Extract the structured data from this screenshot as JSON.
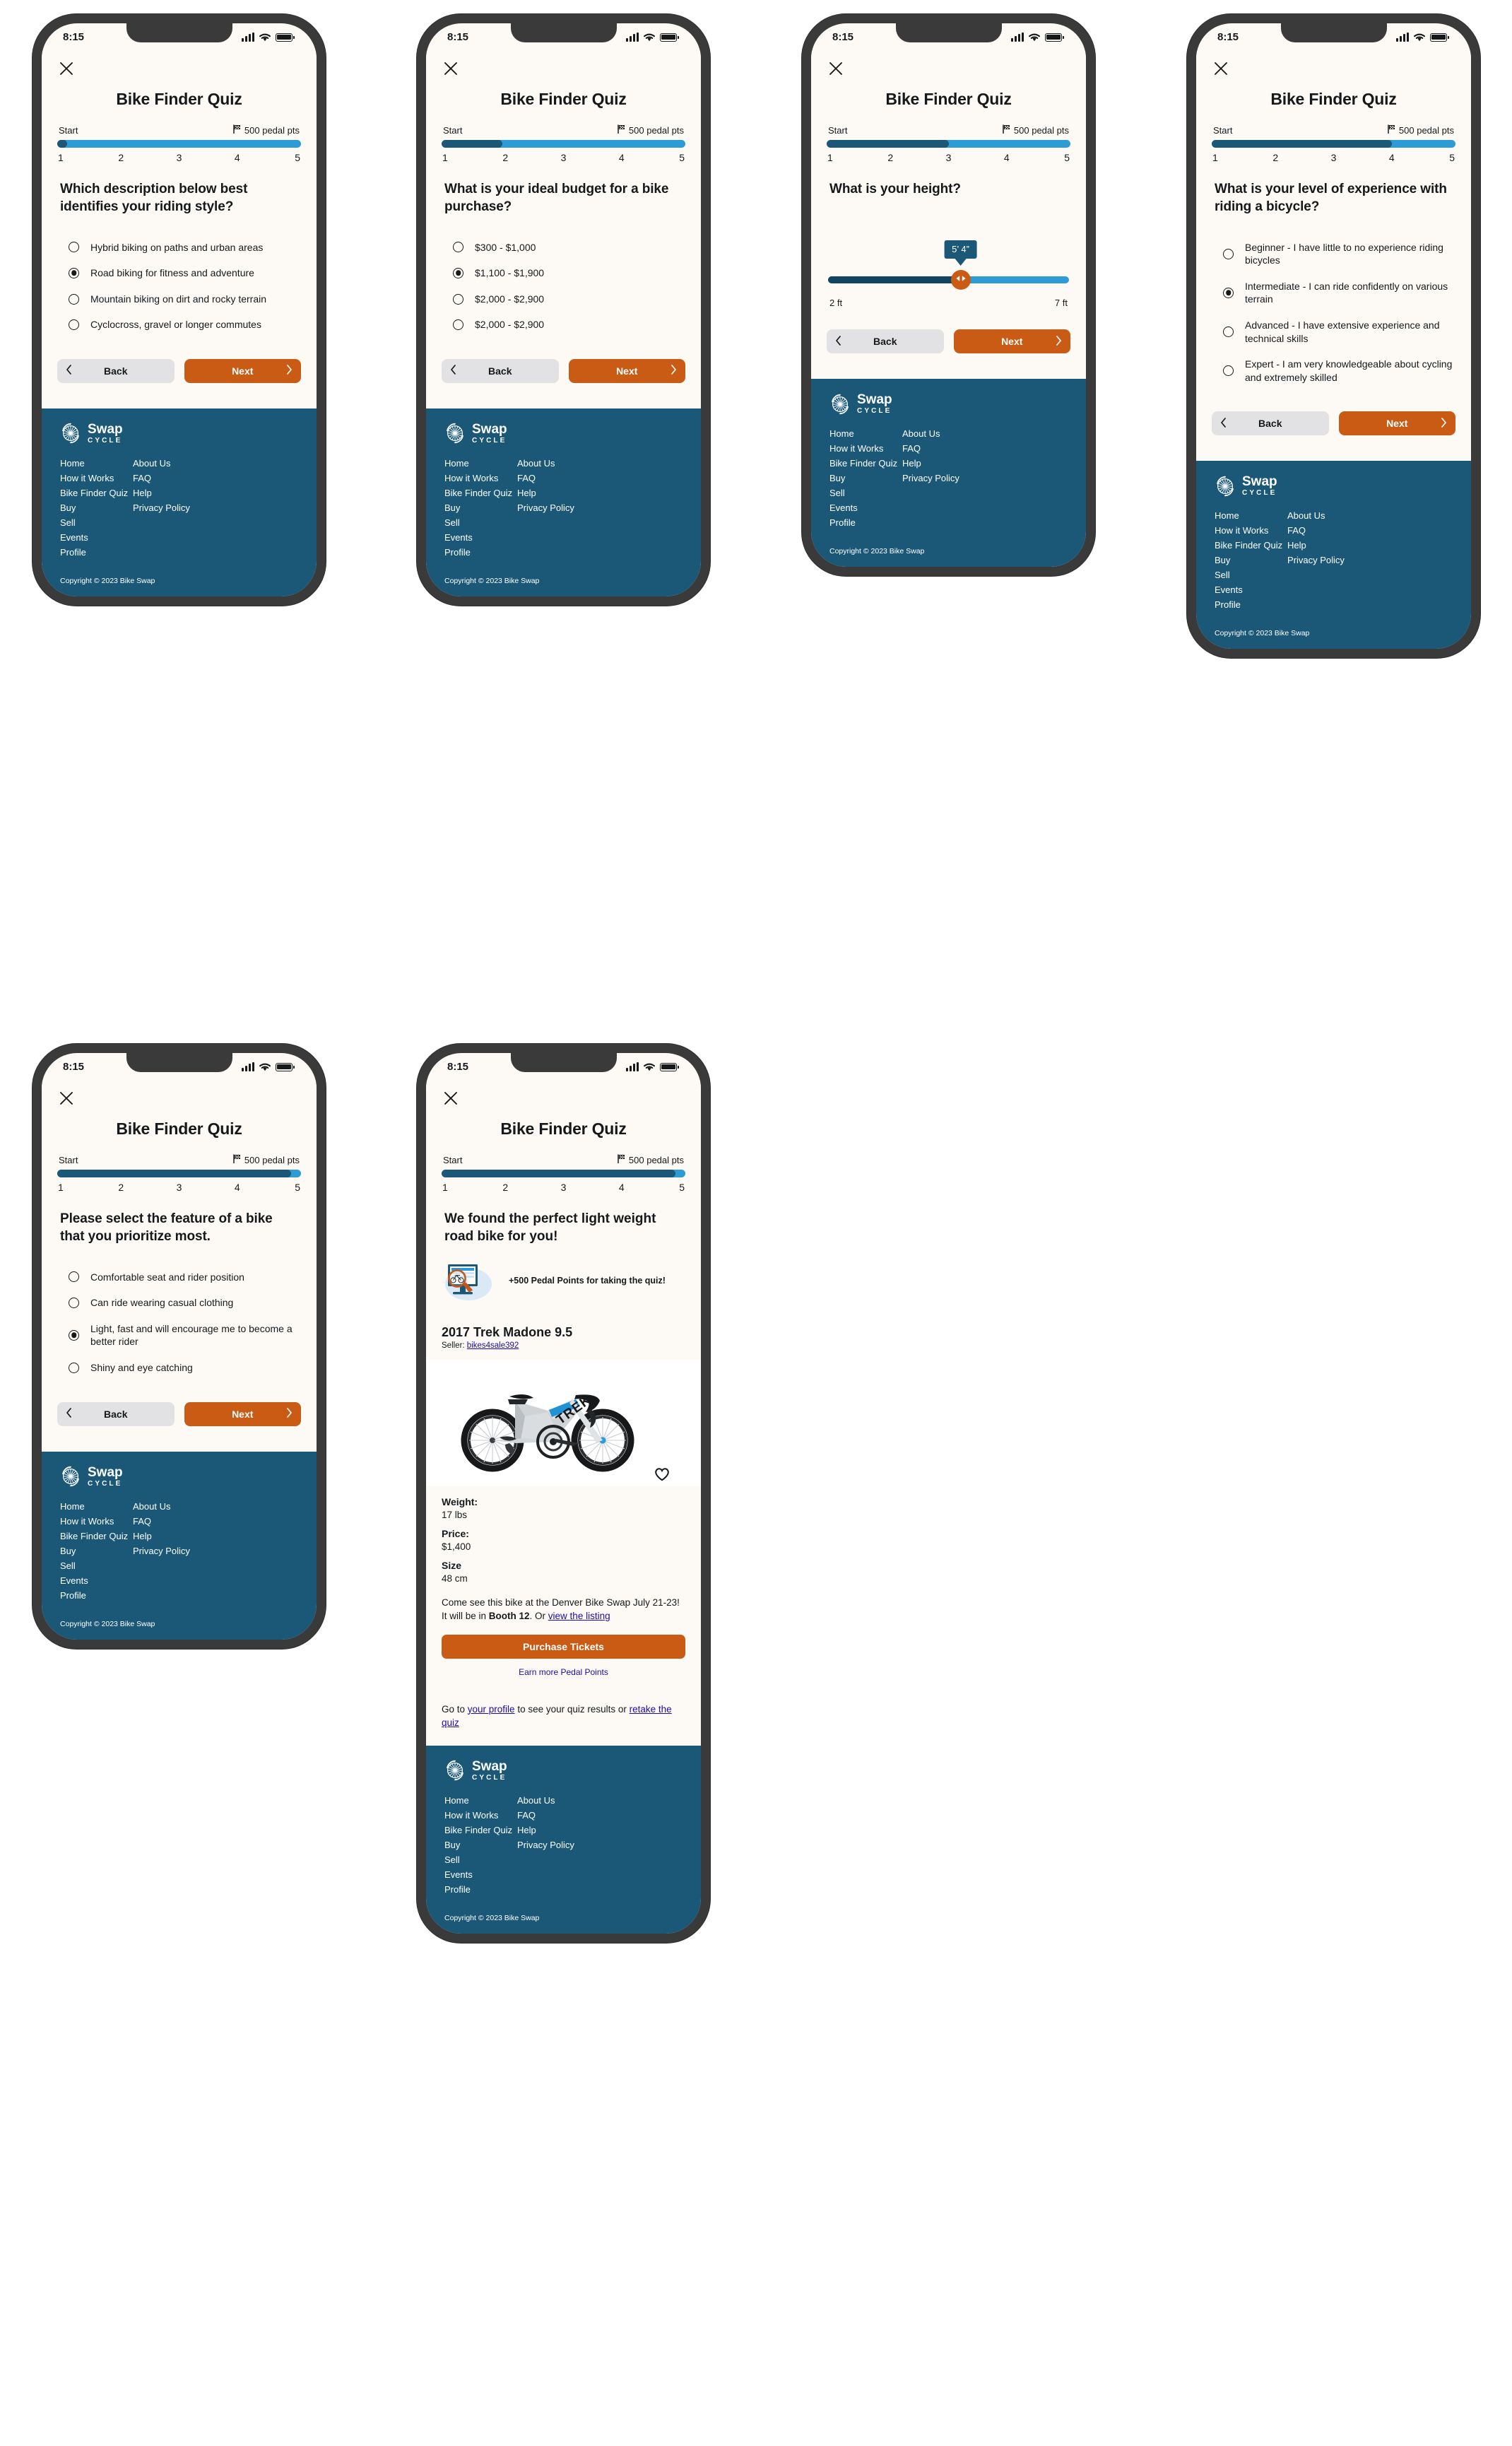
{
  "colors": {
    "screen_bg": "#fdfaf5",
    "bezel": "#3a3a3a",
    "brand_navy": "#1b5878",
    "brand_blue": "#2d9cd6",
    "accent_orange": "#ca5b15",
    "link_blue": "#1a0dab",
    "text": "#15191c",
    "btn_back_bg": "#e2e2e4"
  },
  "status_bar": {
    "time": "8:15",
    "icons": [
      "signal-icon",
      "wifi-icon",
      "battery-icon"
    ]
  },
  "quiz": {
    "title": "Bike Finder Quiz",
    "close_icon": "close-icon",
    "progress": {
      "start_label": "Start",
      "finish_label": "500 pedal pts",
      "finish_icon": "checkered-flag-icon",
      "ticks": [
        "1",
        "2",
        "3",
        "4",
        "5"
      ]
    },
    "buttons": {
      "back": "Back",
      "next": "Next",
      "back_icon": "chevron-left-icon",
      "next_icon": "chevron-right-icon"
    }
  },
  "screens": [
    {
      "step": 1,
      "progress_pct": 4,
      "question": "Which description below best identifies your riding style?",
      "options": [
        {
          "label": "Hybrid biking on paths and urban areas",
          "selected": false
        },
        {
          "label": "Road biking for fitness and adventure",
          "selected": true
        },
        {
          "label": "Mountain biking on dirt and rocky terrain",
          "selected": false
        },
        {
          "label": "Cyclocross, gravel or longer commutes",
          "selected": false
        }
      ]
    },
    {
      "step": 2,
      "progress_pct": 25,
      "question": "What is your ideal budget for a bike purchase?",
      "options": [
        {
          "label": "$300 - $1,000",
          "selected": false
        },
        {
          "label": "$1,100 - $1,900",
          "selected": true
        },
        {
          "label": "$2,000 - $2,900",
          "selected": false
        },
        {
          "label": "$2,000 - $2,900",
          "selected": false
        }
      ]
    },
    {
      "step": 3,
      "progress_pct": 50,
      "question": "What is your height?",
      "slider": {
        "value_label": "5’ 4”",
        "min_label": "2 ft",
        "max_label": "7 ft",
        "thumb_pct": 55,
        "thumb_icon": "left-right-arrows-icon"
      }
    },
    {
      "step": 4,
      "progress_pct": 74,
      "question": "What is your level of experience with riding a bicycle?",
      "options": [
        {
          "label": "Beginner - I have little to no experience riding bicycles",
          "selected": false
        },
        {
          "label": "Intermediate - I can ride confidently on various terrain",
          "selected": true
        },
        {
          "label": "Advanced - I have extensive experience and technical skills",
          "selected": false
        },
        {
          "label": "Expert - I am very knowledgeable about cycling and extremely skilled",
          "selected": false
        }
      ]
    },
    {
      "step": 5,
      "progress_pct": 96,
      "question": "Please select the feature of a bike that you prioritize most.",
      "options": [
        {
          "label": "Comfortable seat and rider position",
          "selected": false
        },
        {
          "label": "Can ride wearing casual clothing",
          "selected": false
        },
        {
          "label": "Light, fast and will encourage me to become a better rider",
          "selected": true
        },
        {
          "label": "Shiny and eye catching",
          "selected": false
        }
      ]
    }
  ],
  "results": {
    "step": 5,
    "progress_pct": 96,
    "headline": "We found the perfect light weight road bike for you!",
    "reward_illustration_icon": "bike-search-illustration",
    "reward_text": "+500 Pedal Points for taking the quiz!",
    "bike_name": "2017 Trek Madone 9.5",
    "seller_prefix": "Seller: ",
    "seller_name": "bikes4sale392",
    "bike_photo_icon": "road-bike-photo",
    "favorite_icon": "heart-icon",
    "specs": [
      {
        "label": "Weight:",
        "value": "17 lbs"
      },
      {
        "label": "Price:",
        "value": "$1,400"
      },
      {
        "label": "Size",
        "value": "48 cm"
      }
    ],
    "blurb_part1": "Come see this bike at the Denver Bike Swap July 21-23! It will be in ",
    "blurb_booth": "Booth 12",
    "blurb_part2": ". Or ",
    "blurb_link": "view the listing",
    "purchase_button": "Purchase Tickets",
    "earn_link": "Earn more Pedal Points",
    "outro_part1": "Go to ",
    "outro_link1": "your profile",
    "outro_part2": " to see your quiz results or ",
    "outro_link2": "retake the quiz"
  },
  "footer": {
    "brand_name": "Swap",
    "brand_sub": "CYCLE",
    "brand_mark_icon": "swap-cycle-wheel-logo",
    "column_left": [
      "Home",
      "How it Works",
      "Bike Finder Quiz",
      "Buy",
      "Sell",
      "Events",
      "Profile"
    ],
    "column_right": [
      "About Us",
      "FAQ",
      "Help",
      "Privacy Policy"
    ],
    "copyright": "Copyright © 2023 Bike Swap"
  }
}
